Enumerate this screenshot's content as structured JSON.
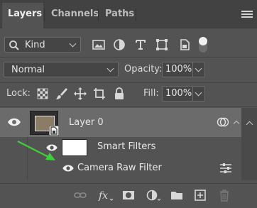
{
  "tabs": [
    {
      "label": "Layers",
      "active": true
    },
    {
      "label": "Channels",
      "active": false
    },
    {
      "label": "Paths",
      "active": false
    }
  ],
  "filter": {
    "kind_label": "Kind",
    "icons": [
      "image-filter-icon",
      "adjustment-filter-icon",
      "type-filter-icon",
      "shape-filter-icon",
      "smart-object-filter-icon"
    ],
    "toggle_on": true
  },
  "blend": {
    "mode": "Normal",
    "opacity_label": "Opacity:",
    "opacity_value": "100%"
  },
  "lock": {
    "label": "Lock:",
    "icons": [
      "lock-transparent-icon",
      "lock-image-icon",
      "lock-position-icon",
      "lock-artboard-icon",
      "lock-all-icon"
    ],
    "fill_label": "Fill:",
    "fill_value": "100%"
  },
  "layers": {
    "layer0_name": "Layer 0",
    "smart_filters_label": "Smart Filters",
    "filter_name": "Camera Raw Filter"
  },
  "bottom_icons": [
    "link-layers-icon",
    "fx-icon",
    "add-mask-icon",
    "adjustment-layer-icon",
    "group-folder-icon",
    "new-layer-icon",
    "delete-layer-icon"
  ],
  "colors": {
    "panel_bg": "#535353",
    "selected_row": "#6b6b6b",
    "annotation_arrow": "#3ecf3a"
  }
}
